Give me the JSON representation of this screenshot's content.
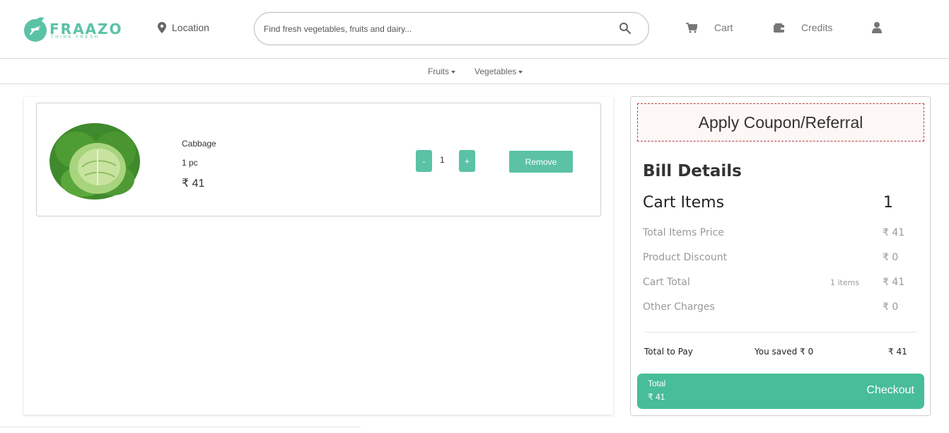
{
  "brand": {
    "name": "FRAAZO",
    "tagline": "THINK FRESH",
    "color": "#5bc2a6"
  },
  "header": {
    "location_label": "Location",
    "search_placeholder": "Find fresh vegetables, fruits and dairy...",
    "cart_label": "Cart",
    "credits_label": "Credits"
  },
  "subnav": {
    "items": [
      {
        "label": "Fruits"
      },
      {
        "label": "Vegetables"
      }
    ]
  },
  "cart": {
    "items": [
      {
        "name": "Cabbage",
        "unit": "1 pc",
        "price": "₹ 41",
        "quantity": "1",
        "minus_label": "-",
        "plus_label": "+",
        "remove_label": "Remove"
      }
    ]
  },
  "bill": {
    "coupon_label": "Apply Coupon/Referral",
    "title": "Bill Details",
    "cart_items_label": "Cart Items",
    "cart_items_count": "1",
    "rows": [
      {
        "label": "Total Items Price",
        "value": "₹ 41"
      },
      {
        "label": "Product Discount",
        "value": "₹ 0"
      },
      {
        "label": "Cart Total",
        "note": "1 items",
        "value": "₹ 41"
      },
      {
        "label": "Other Charges",
        "value": "₹ 0"
      }
    ],
    "total_to_pay_label": "Total to Pay",
    "saved_label": "You saved ₹ 0",
    "total_to_pay_value": "₹ 41",
    "checkout": {
      "total_label": "Total",
      "total_value": "₹ 41",
      "button_label": "Checkout",
      "color": "#47bd98"
    }
  }
}
